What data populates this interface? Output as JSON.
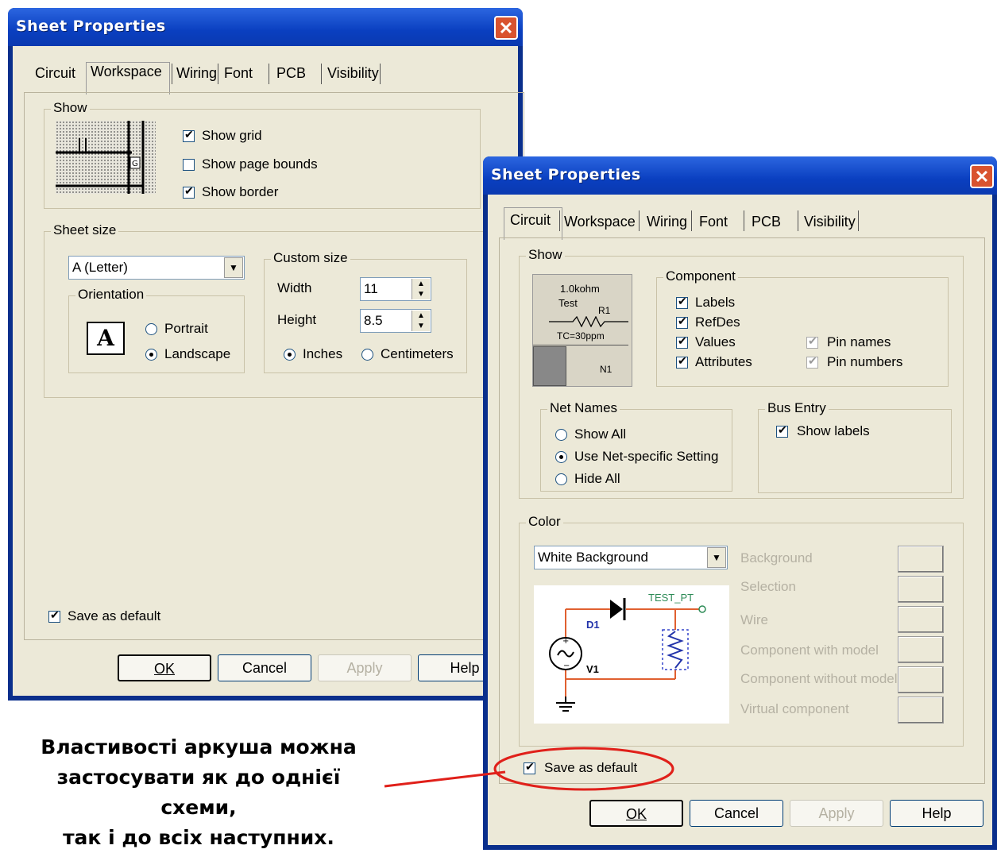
{
  "win1": {
    "title": "Sheet Properties",
    "tabs": [
      "Circuit",
      "Workspace",
      "Wiring",
      "Font",
      "PCB",
      "Visibility"
    ],
    "active_tab": "Workspace",
    "show": {
      "legend": "Show",
      "items": [
        {
          "label": "Show grid",
          "checked": true
        },
        {
          "label": "Show page bounds",
          "checked": false
        },
        {
          "label": "Show border",
          "checked": true
        }
      ]
    },
    "sheet_size": {
      "legend": "Sheet size",
      "selected": "A (Letter)",
      "orientation": {
        "legend": "Orientation",
        "portrait": "Portrait",
        "landscape": "Landscape",
        "selected": "Landscape"
      },
      "custom": {
        "legend": "Custom size",
        "width_label": "Width",
        "width": "11",
        "height_label": "Height",
        "height": "8.5",
        "inches": "Inches",
        "centimeters": "Centimeters",
        "selected_unit": "Inches"
      }
    },
    "save_default": {
      "label": "Save as default",
      "checked": true
    },
    "buttons": {
      "ok": "OK",
      "cancel": "Cancel",
      "apply": "Apply",
      "help": "Help"
    }
  },
  "win2": {
    "title": "Sheet Properties",
    "tabs": [
      "Circuit",
      "Workspace",
      "Wiring",
      "Font",
      "PCB",
      "Visibility"
    ],
    "active_tab": "Circuit",
    "show_legend": "Show",
    "preview": {
      "line1": "1.0kohm",
      "line2": "Test",
      "ref": "R1",
      "tc": "TC=30ppm",
      "net": "N1"
    },
    "component": {
      "legend": "Component",
      "left": [
        {
          "label": "Labels",
          "checked": true
        },
        {
          "label": "RefDes",
          "checked": true
        },
        {
          "label": "Values",
          "checked": true
        },
        {
          "label": "Attributes",
          "checked": true
        }
      ],
      "right": [
        {
          "label": "Pin names",
          "checked": true
        },
        {
          "label": "Pin numbers",
          "checked": true
        }
      ]
    },
    "net_names": {
      "legend": "Net Names",
      "options": [
        "Show All",
        "Use Net-specific Setting",
        "Hide All"
      ],
      "selected": "Use Net-specific Setting"
    },
    "bus_entry": {
      "legend": "Bus Entry",
      "label": "Show labels",
      "checked": true
    },
    "color": {
      "legend": "Color",
      "selected": "White Background",
      "items": [
        "Background",
        "Selection",
        "Wire",
        "Component with model",
        "Component without model",
        "Virtual component"
      ],
      "diagram": {
        "test_pt": "TEST_PT",
        "d1": "D1",
        "v1": "V1"
      }
    },
    "save_default": {
      "label": "Save as default",
      "checked": true
    },
    "buttons": {
      "ok": "OK",
      "cancel": "Cancel",
      "apply": "Apply",
      "help": "Help"
    }
  },
  "caption": {
    "lines": [
      "Властивості аркуша можна",
      "застосувати як до однієї схеми,",
      "так і до всіх наступних."
    ]
  },
  "colors": {
    "title_bar": "#0a3fc0",
    "dialog_face": "#ece9d8",
    "highlight": "#e0201a",
    "wire": "#e06030",
    "test_pt": "#2e8b57"
  }
}
